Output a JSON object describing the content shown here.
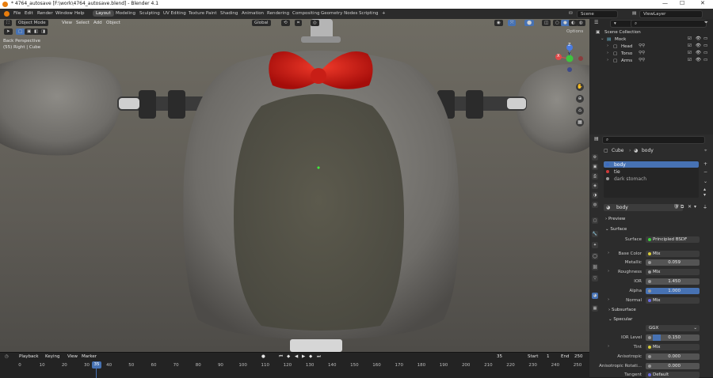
{
  "titlebar": {
    "title": "* 4764_autosave [F:\\work\\4764_autosave.blend] - Blender 4.1",
    "min": "—",
    "max": "☐",
    "close": "✕"
  },
  "menu": {
    "file": "File",
    "edit": "Edit",
    "render": "Render",
    "window": "Window",
    "help": "Help"
  },
  "workspaces": [
    "Layout",
    "Modeling",
    "Sculpting",
    "UV Editing",
    "Texture Paint",
    "Shading",
    "Animation",
    "Rendering",
    "Compositing",
    "Geometry Nodes",
    "Scripting"
  ],
  "scene": {
    "name": "Scene",
    "view_layer": "ViewLayer"
  },
  "viewport": {
    "mode": "Object Mode",
    "view": "View",
    "select": "Select",
    "add": "Add",
    "object": "Object",
    "orientation": "Global",
    "options": "Options",
    "perspective_label": "Back Perspective",
    "object_label": "(55) Right | Cube",
    "gizmo": {
      "x": "X",
      "y": "Y",
      "z": "Z"
    }
  },
  "timeline": {
    "playback": "Playback",
    "keying": "Keying",
    "view": "View",
    "marker": "Marker",
    "current_frame": "35",
    "start_label": "Start",
    "start": "1",
    "end_label": "End",
    "end": "250",
    "ticks": [
      "0",
      "10",
      "20",
      "30",
      "40",
      "50",
      "60",
      "70",
      "80",
      "90",
      "100",
      "110",
      "120",
      "130",
      "140",
      "150",
      "160",
      "170",
      "180",
      "190",
      "200",
      "210",
      "220",
      "230",
      "240",
      "250"
    ]
  },
  "outliner": {
    "search_placeholder": "",
    "scene_collection": "Scene Collection",
    "items": [
      {
        "name": "Mock"
      },
      {
        "name": "Head"
      },
      {
        "name": "Torso"
      },
      {
        "name": "Arms"
      }
    ]
  },
  "properties": {
    "search_placeholder": "",
    "breadcrumb_object": "Cube",
    "breadcrumb_material": "body",
    "slots": [
      {
        "name": "body",
        "color": "#3a6ac2"
      },
      {
        "name": "tie",
        "color": "#d03a3a"
      },
      {
        "name": "dark stomach",
        "color": "#9a9a9a"
      }
    ],
    "material_name": "body",
    "preview": "Preview",
    "surface": "Surface",
    "rows": [
      {
        "label": "Surface",
        "value": "Principled BSDF"
      },
      {
        "label": "Base Color",
        "value": "Mix"
      },
      {
        "label": "Metallic",
        "value": "0.059"
      },
      {
        "label": "Roughness",
        "value": "Mix"
      },
      {
        "label": "IOR",
        "value": "1.450"
      },
      {
        "label": "Alpha",
        "value": "1.000"
      },
      {
        "label": "Normal",
        "value": "Mix"
      }
    ],
    "subsurface": "Subsurface",
    "specular": "Specular",
    "spec_mode": "GGX",
    "spec_rows": [
      {
        "label": "IOR Level",
        "value": "0.150"
      },
      {
        "label": "Tint",
        "value": "Mix"
      },
      {
        "label": "Anisotropic",
        "value": "0.000"
      },
      {
        "label": "Anisotropic Rotati...",
        "value": "0.000"
      },
      {
        "label": "Tangent",
        "value": "Default"
      }
    ]
  }
}
